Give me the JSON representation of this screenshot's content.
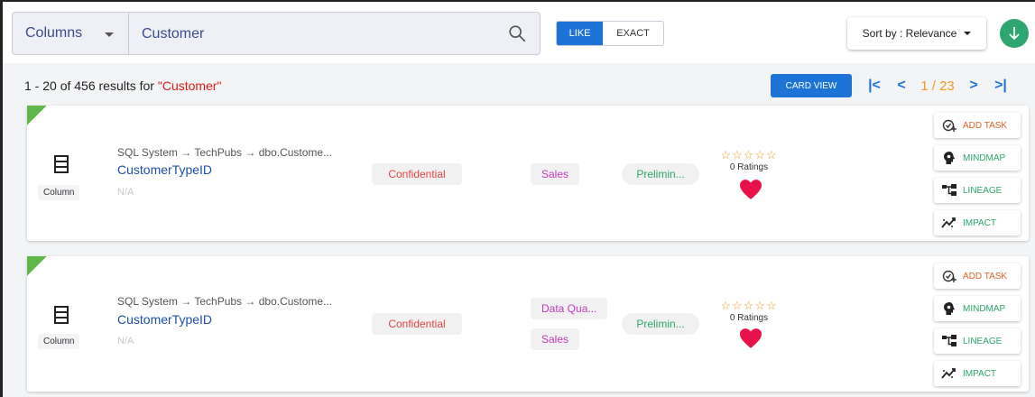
{
  "search": {
    "scope": "Columns",
    "query": "Customer",
    "placeholder": "Search"
  },
  "match_mode": {
    "like": "LIKE",
    "exact": "EXACT",
    "selected": "LIKE"
  },
  "sort": {
    "label": "Sort by : Relevance"
  },
  "results": {
    "summary_prefix": "1 - 20 of 456 results for ",
    "query_quoted": "\"Customer\"",
    "card_view_label": "CARD VIEW",
    "page_indicator": "1 / 23"
  },
  "cards": [
    {
      "type_label": "Column",
      "path": "SQL System → TechPubs → dbo.Custome...",
      "name": "CustomerTypeID",
      "description": "N/A",
      "classification": "Confidential",
      "tags": [
        "Sales"
      ],
      "status": "Prelimin...",
      "stars": "☆☆☆☆☆",
      "ratings_text": "0 Ratings",
      "actions": {
        "add_task": "ADD TASK",
        "mindmap": "MINDMAP",
        "lineage": "LINEAGE",
        "impact": "IMPACT"
      }
    },
    {
      "type_label": "Column",
      "path": "SQL System → TechPubs → dbo.Custome...",
      "name": "CustomerTypeID",
      "description": "N/A",
      "classification": "Confidential",
      "tags": [
        "Data Qua...",
        "Sales"
      ],
      "status": "Prelimin...",
      "stars": "☆☆☆☆☆",
      "ratings_text": "0 Ratings",
      "actions": {
        "add_task": "ADD TASK",
        "mindmap": "MINDMAP",
        "lineage": "LINEAGE",
        "impact": "IMPACT"
      }
    }
  ],
  "colors": {
    "primary": "#1e73d6",
    "accent_orange": "#f09a20",
    "success_green": "#2ea66f",
    "query_red": "#e01b1b",
    "heart": "#e8124a"
  }
}
